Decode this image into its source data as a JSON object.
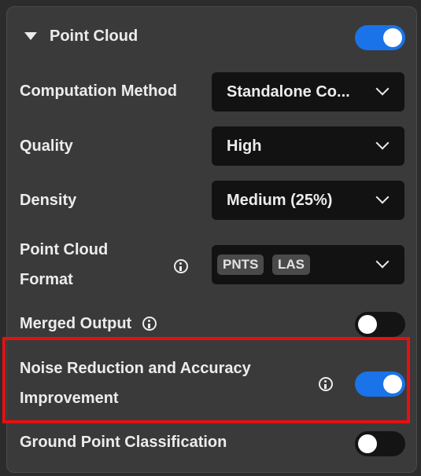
{
  "section": {
    "title": "Point Cloud",
    "enabled": true
  },
  "fields": {
    "computation_method": {
      "label": "Computation Method",
      "value": "Standalone Co..."
    },
    "quality": {
      "label": "Quality",
      "value": "High"
    },
    "density": {
      "label": "Density",
      "value": "Medium (25%)"
    },
    "point_cloud_format": {
      "label_line1": "Point Cloud",
      "label_line2": "Format",
      "tags": [
        "PNTS",
        "LAS"
      ]
    },
    "merged_output": {
      "label": "Merged Output",
      "enabled": false
    },
    "noise_reduction": {
      "label_line1": "Noise Reduction and Accuracy",
      "label_line2": "Improvement",
      "enabled": true
    },
    "ground_point_classification": {
      "label": "Ground Point Classification",
      "enabled": false
    }
  },
  "colors": {
    "toggle_on": "#1a73e8",
    "toggle_off": "#141414",
    "highlight": "#e51010",
    "panel": "#3a3a3a"
  },
  "icons": {
    "section_caret": "caret-down-icon",
    "dropdown": "chevron-down-icon",
    "info": "info-icon"
  }
}
